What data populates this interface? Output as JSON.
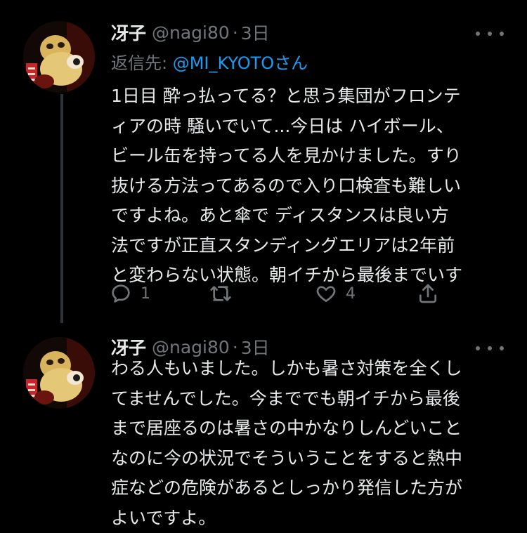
{
  "tweets": [
    {
      "name": "冴子",
      "handle": "@nagi80",
      "dot": "·",
      "time": "3日",
      "reply_prefix": "返信先: ",
      "reply_mention": "@MI_KYOTO",
      "reply_suffix": "さん",
      "text": "1日目 酔っ払ってる？と思う集団がフロンテ\nィアの時 騒いでいて...今日は ハイボール、\nビール缶を持ってる人を見かけました。すり\n抜ける方法ってあるので入り口検査も難しい\nですよね。あと傘で ディスタンスは良い方\n法ですが正直スタンディングエリアは2年前\nと変わらない状態。朝イチから最後までいす",
      "actions": {
        "reply_count": "1",
        "retweet_count": "",
        "like_count": "4"
      }
    },
    {
      "name": "冴子",
      "handle": "@nagi80",
      "dot": "·",
      "time": "3日",
      "text": "わる人もいました。しかも暑さ対策を全くし\nてませんでした。今まででも朝イチから最後\nまで居座るのは暑さの中かなりしんどいこと\nなのに今の状況でそういうことをすると熱中\n症などの危険があるとしっかり発信した方が\nよいですよ。"
    }
  ],
  "colors": {
    "background": "#000000",
    "text": "#e7e9ea",
    "secondary": "#71767b",
    "mention": "#1d9bf0",
    "thread_line": "#2f3336"
  },
  "icons": [
    "more-icon",
    "reply-icon",
    "retweet-icon",
    "like-icon",
    "share-icon"
  ]
}
